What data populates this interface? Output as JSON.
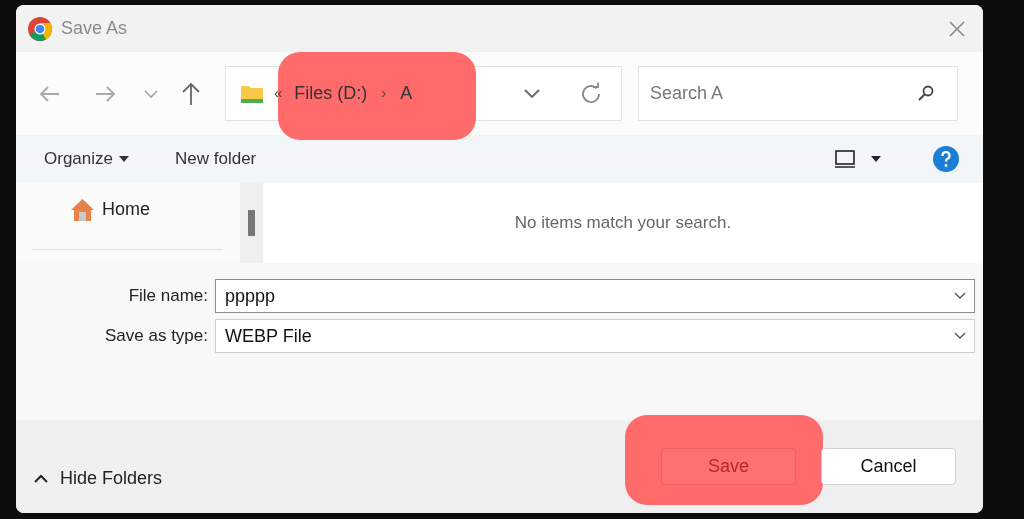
{
  "window": {
    "title": "Save As"
  },
  "address": {
    "overflow": "«",
    "crumbs": [
      "Files (D:)",
      "A"
    ],
    "separator": "›",
    "highlighted": true
  },
  "search": {
    "placeholder": "Search A"
  },
  "toolbar": {
    "organize": "Organize",
    "new_folder": "New folder"
  },
  "nav_pane": {
    "items": [
      {
        "label": "Home"
      }
    ]
  },
  "content": {
    "message": "No items match your search."
  },
  "fields": [
    {
      "label": "File name:",
      "value": "ppppp"
    },
    {
      "label": "Save as type:",
      "value": "WEBP File"
    }
  ],
  "footer": {
    "hide_folders": "Hide Folders",
    "buttons": [
      {
        "label": "Save",
        "highlighted": true
      },
      {
        "label": "Cancel",
        "highlighted": false
      }
    ]
  }
}
